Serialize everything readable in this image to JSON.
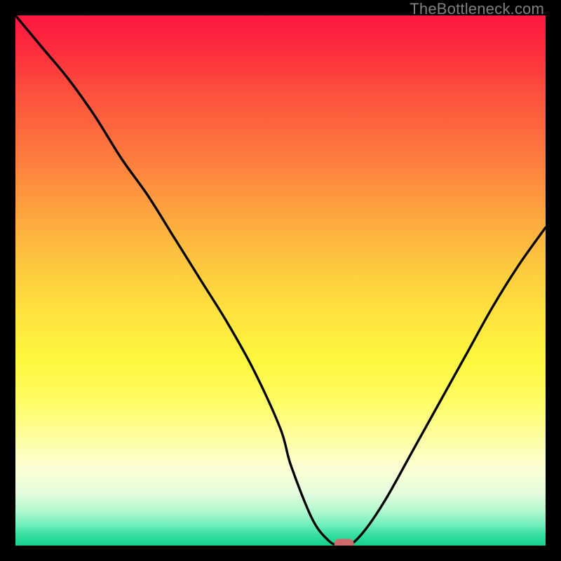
{
  "watermark": "TheBottleneck.com",
  "chart_data": {
    "type": "line",
    "title": "",
    "xlabel": "",
    "ylabel": "",
    "xlim": [
      0,
      100
    ],
    "ylim": [
      0,
      100
    ],
    "legend": false,
    "grid": false,
    "background_gradient": {
      "from": "red",
      "to": "green",
      "via": [
        "orange",
        "yellow",
        "pale-yellow"
      ]
    },
    "series": [
      {
        "name": "bottleneck-curve",
        "color": "#000000",
        "x": [
          0,
          5,
          10,
          15,
          20,
          25,
          30,
          35,
          40,
          45,
          50,
          52,
          56,
          59,
          61,
          63,
          66,
          70,
          75,
          80,
          85,
          90,
          95,
          100
        ],
        "y": [
          100,
          94,
          88,
          81,
          73,
          66,
          58,
          50,
          42,
          33,
          22,
          15,
          5,
          1,
          0,
          0,
          3,
          9,
          18,
          27,
          36,
          45,
          53,
          60
        ]
      }
    ],
    "marker": {
      "name": "optimal-point",
      "x": 62,
      "y": 0,
      "color": "#cd6b6a",
      "shape": "rounded-rect"
    }
  }
}
